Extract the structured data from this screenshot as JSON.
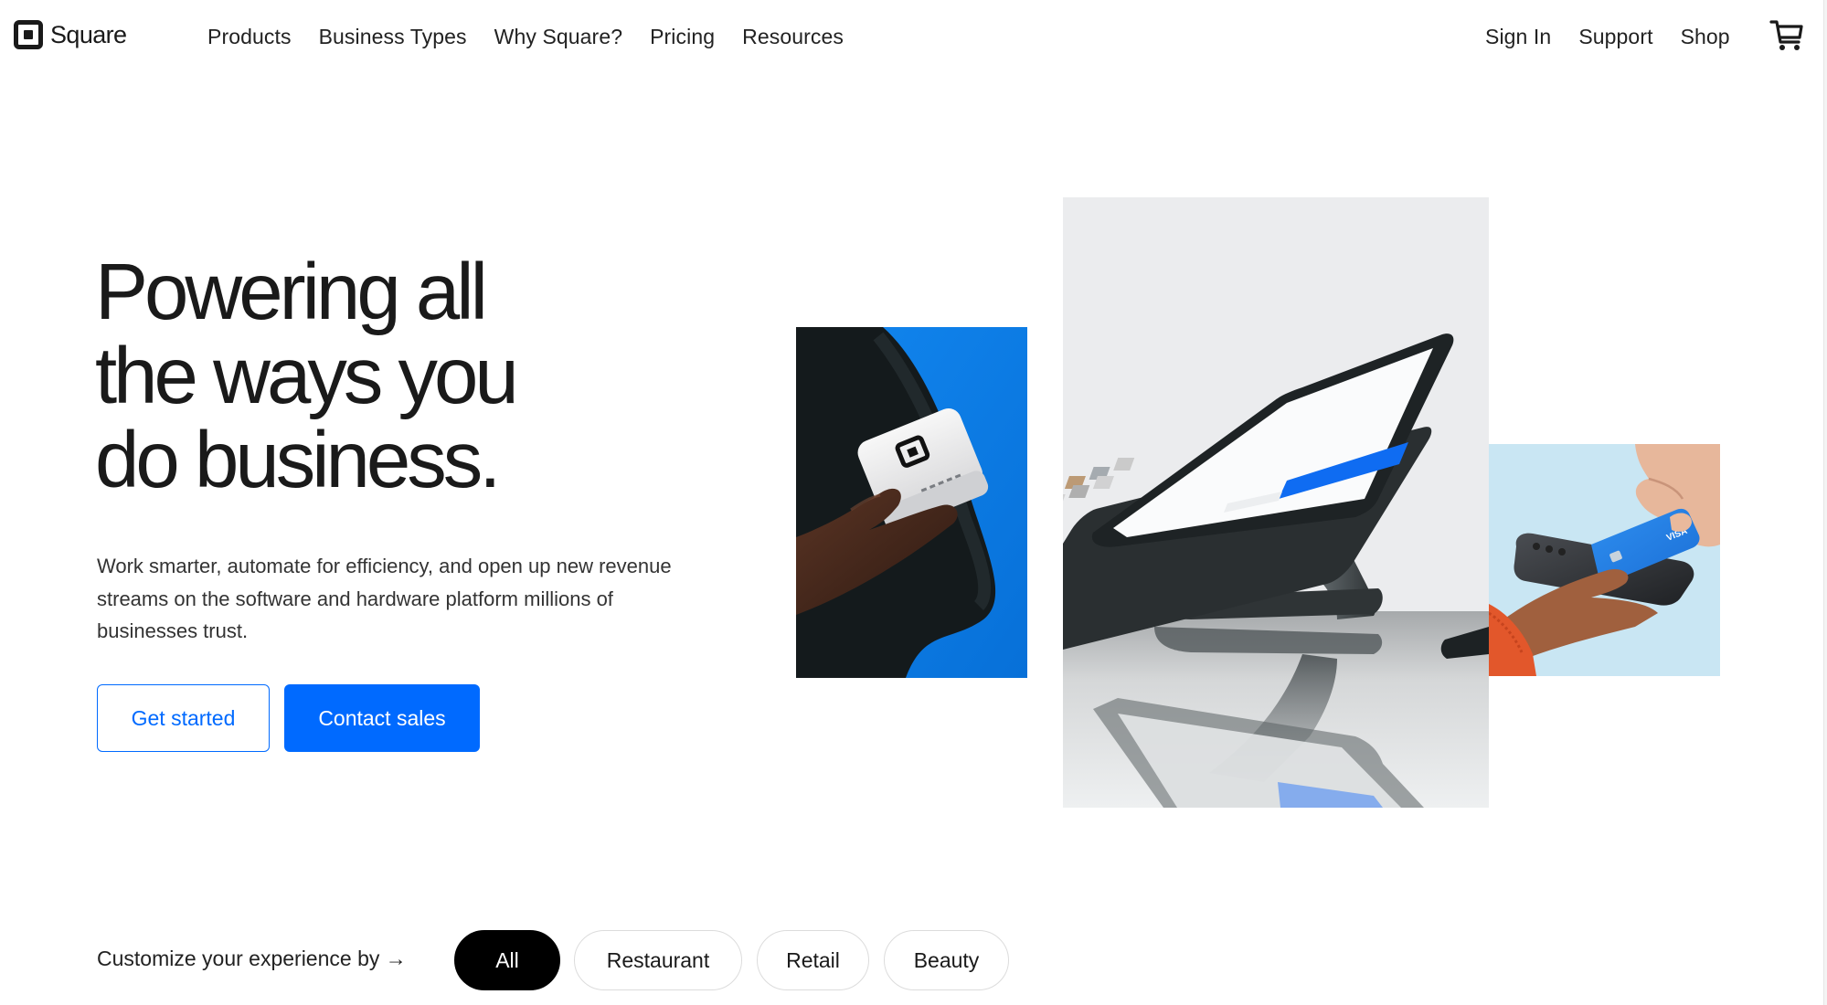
{
  "header": {
    "logo_text": "Square",
    "logo_icon": "square-logo-icon",
    "nav_left": [
      {
        "label": "Products"
      },
      {
        "label": "Business Types"
      },
      {
        "label": "Why Square?"
      },
      {
        "label": "Pricing"
      },
      {
        "label": "Resources"
      }
    ],
    "nav_right": [
      {
        "label": "Sign In"
      },
      {
        "label": "Support"
      },
      {
        "label": "Shop"
      }
    ],
    "cart_icon": "shopping-cart-icon"
  },
  "hero": {
    "headline_lines": [
      "Powering all",
      "the ways you",
      "do business."
    ],
    "lede": "Work smarter, automate for efficiency, and open up new revenue streams on the software and hardware platform millions of businesses trust.",
    "primary_cta": "Contact sales",
    "secondary_cta": "Get started",
    "images": [
      {
        "name": "hand-holding-square-terminal",
        "description": "Hand holding white Square terminal on blue background"
      },
      {
        "name": "square-register-tablet",
        "description": "Square Register tablet on stand with reflection"
      },
      {
        "name": "tap-to-pay-phone",
        "description": "Visa card tapping a smartphone on light blue background"
      }
    ]
  },
  "filters": {
    "label": "Customize your experience by →",
    "options": [
      {
        "label": "All",
        "selected": true
      },
      {
        "label": "Restaurant",
        "selected": false
      },
      {
        "label": "Retail",
        "selected": false
      },
      {
        "label": "Beauty",
        "selected": false
      }
    ]
  },
  "colors": {
    "brand_blue": "#006aff",
    "text_dark": "#1a1a1a",
    "pill_active": "#000000",
    "terminal_bg_blue": "#0a7de6",
    "tap_bg_blue": "#c9e6f3",
    "register_bg": "#ebecee"
  }
}
